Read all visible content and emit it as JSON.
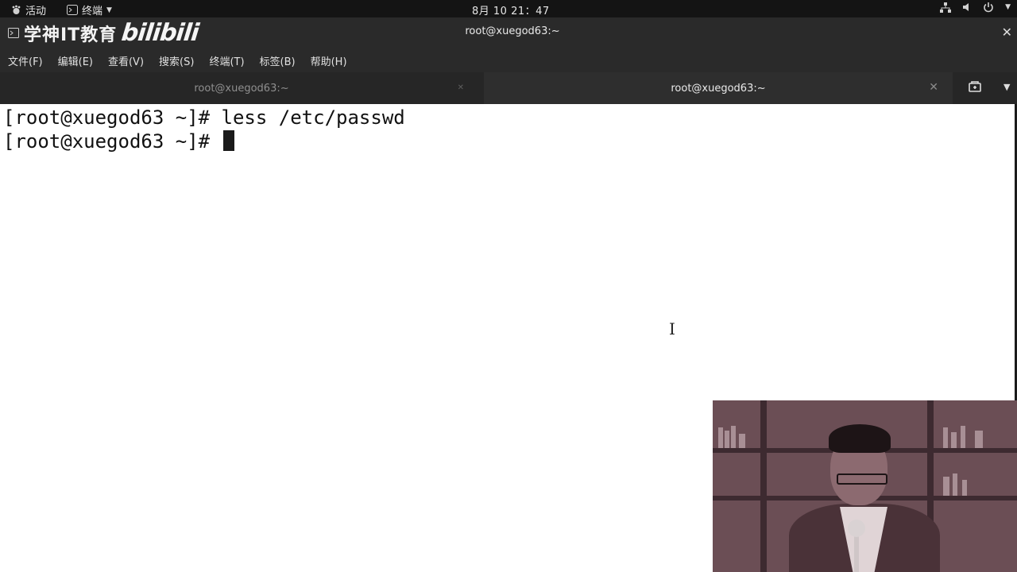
{
  "topbar": {
    "activities_label": "活动",
    "app_label": "终端",
    "clock": "8月 10  21：47"
  },
  "window": {
    "title": "root@xuegod63:~",
    "watermark_text": "学神IT教育",
    "watermark_logo": "bilibili"
  },
  "menu": {
    "items": [
      "文件(F)",
      "编辑(E)",
      "查看(V)",
      "搜索(S)",
      "终端(T)",
      "标签(B)",
      "帮助(H)"
    ]
  },
  "tabs": [
    {
      "label": "root@xuegod63:~",
      "active": false
    },
    {
      "label": "root@xuegod63:~",
      "active": true
    }
  ],
  "terminal": {
    "lines": [
      "[root@xuegod63 ~]# less /etc/passwd",
      "[root@xuegod63 ~]# "
    ]
  },
  "icons": {
    "activities": "gnome-foot-icon",
    "terminal": "terminal-icon",
    "network": "network-icon",
    "volume": "volume-icon",
    "power": "power-icon"
  },
  "colors": {
    "topbar_bg": "#141414",
    "chrome_bg": "#2a2a2a",
    "terminal_bg": "#ffffff",
    "terminal_fg": "#111111"
  }
}
